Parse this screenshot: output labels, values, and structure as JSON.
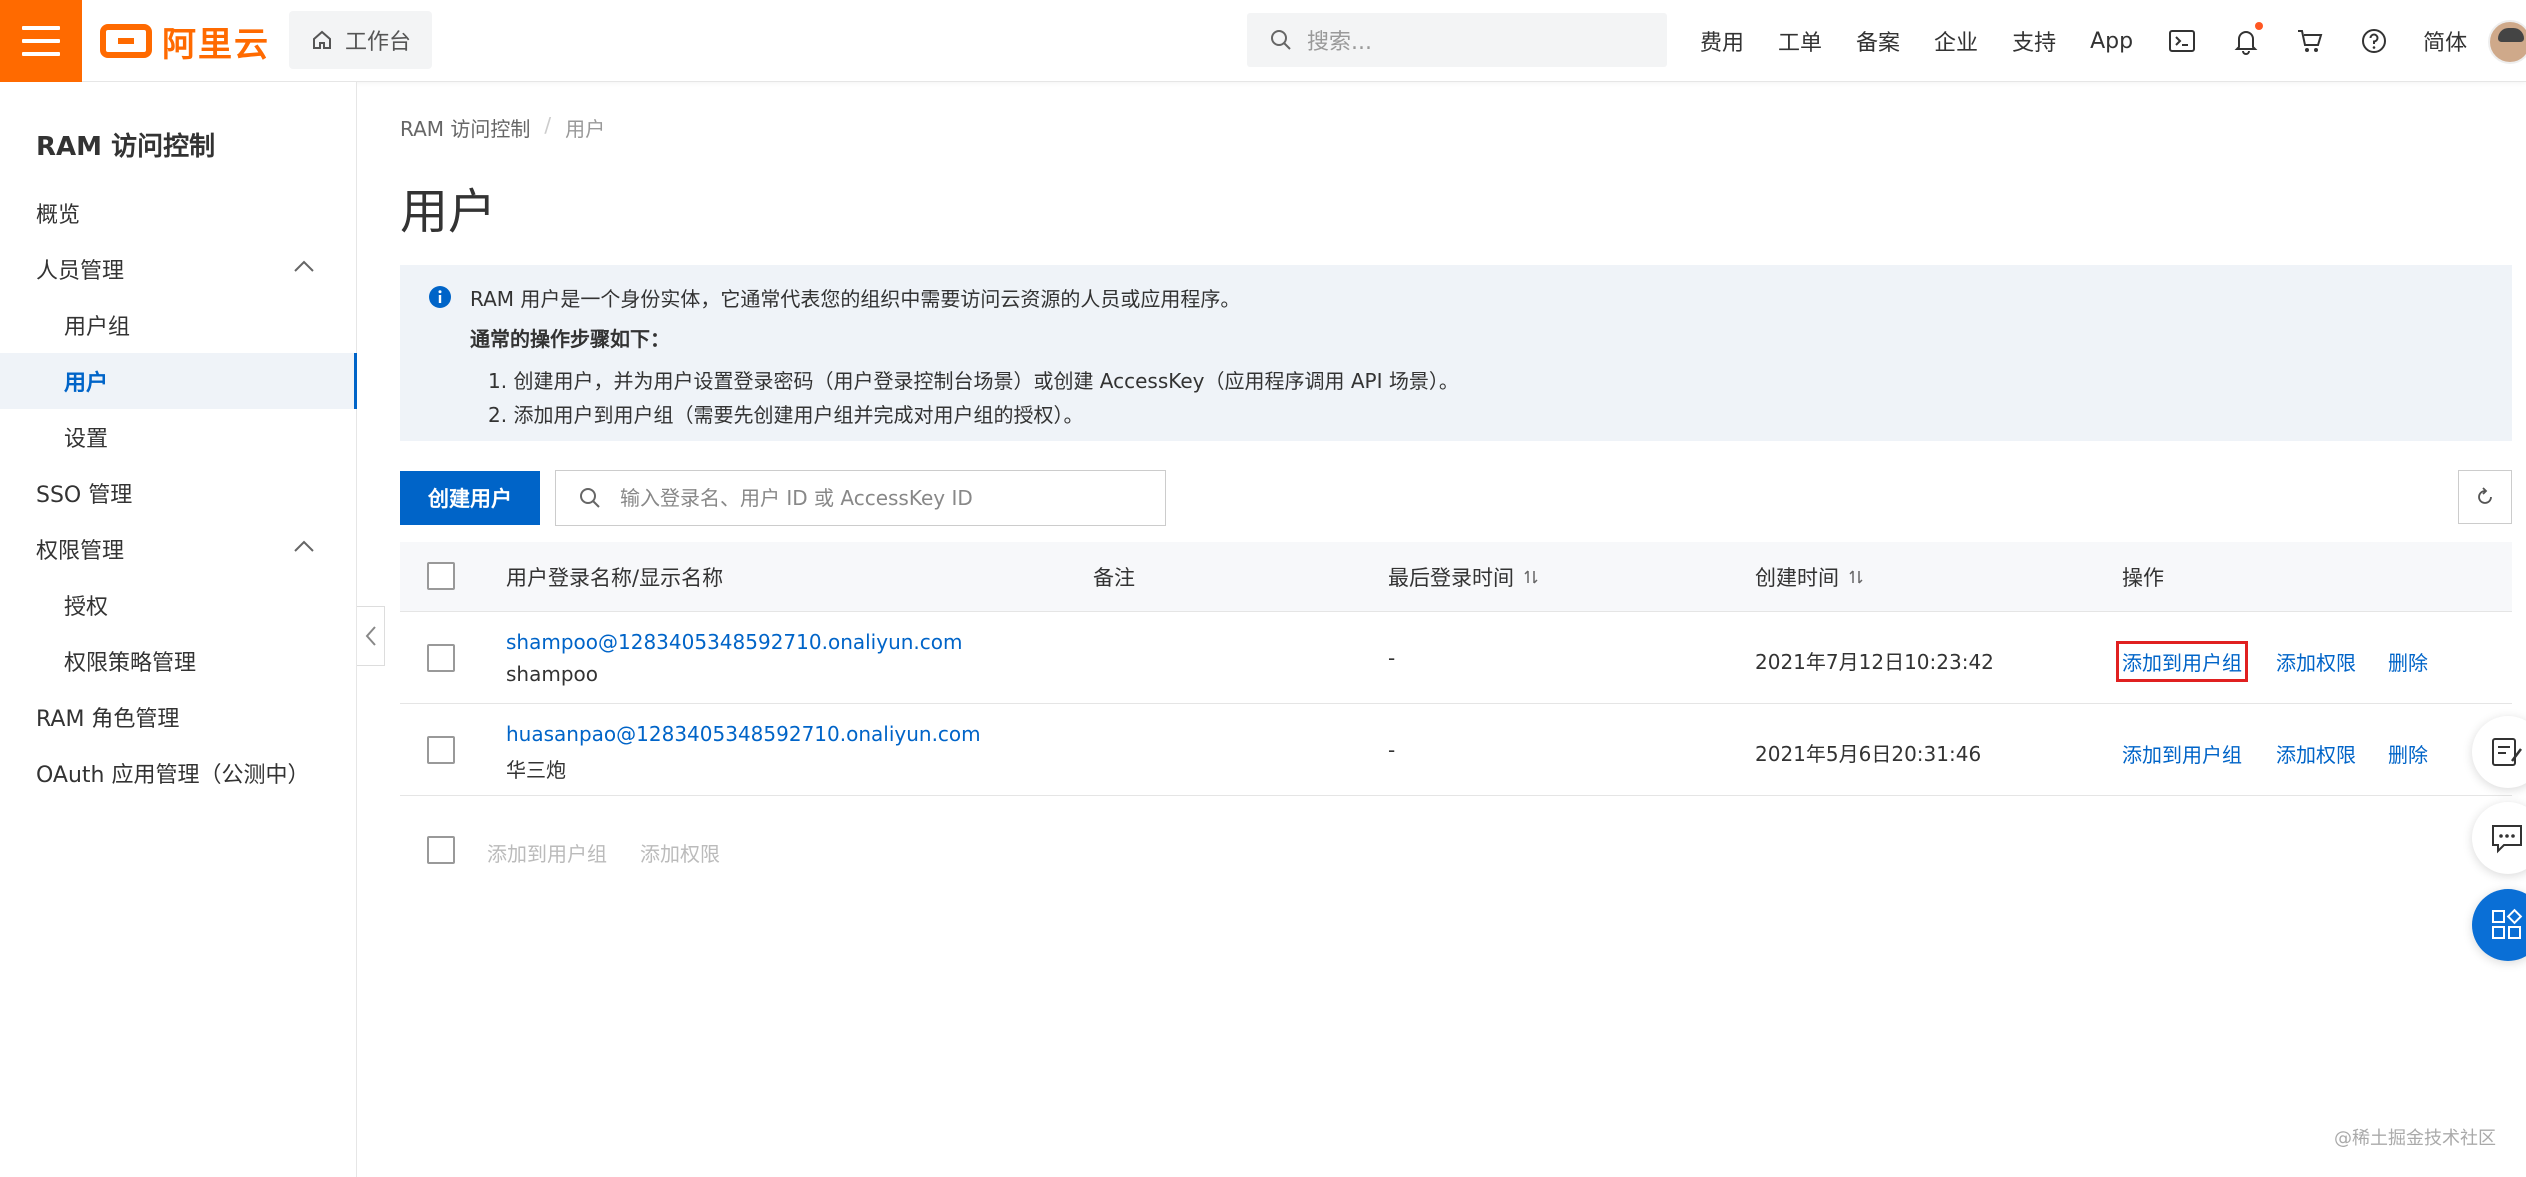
{
  "header": {
    "logo_text": "阿里云",
    "workbench_label": "工作台",
    "search_placeholder": "搜索...",
    "nav": [
      "费用",
      "工单",
      "备案",
      "企业",
      "支持",
      "App"
    ],
    "lang_label": "简体",
    "icons": [
      "terminal-icon",
      "bell-icon",
      "cart-icon",
      "help-icon"
    ]
  },
  "sidebar": {
    "title": "RAM 访问控制",
    "items": [
      {
        "label": "概览"
      },
      {
        "label": "人员管理"
      },
      {
        "label": "用户组"
      },
      {
        "label": "用户"
      },
      {
        "label": "设置"
      },
      {
        "label": "SSO 管理"
      },
      {
        "label": "权限管理"
      },
      {
        "label": "授权"
      },
      {
        "label": "权限策略管理"
      },
      {
        "label": "RAM 角色管理"
      },
      {
        "label": "OAuth 应用管理（公测中）"
      }
    ]
  },
  "breadcrumb": {
    "root": "RAM 访问控制",
    "sep": "/",
    "current": "用户"
  },
  "page_title": "用户",
  "notice": {
    "line1": "RAM 用户是一个身份实体，它通常代表您的组织中需要访问云资源的人员或应用程序。",
    "heading": "通常的操作步骤如下：",
    "step1": "1. 创建用户，并为用户设置登录密码（用户登录控制台场景）或创建 AccessKey（应用程序调用 API 场景）。",
    "step2": "2. 添加用户到用户组（需要先创建用户组并完成对用户组的授权）。"
  },
  "toolbar": {
    "create_label": "创建用户",
    "search_placeholder": "输入登录名、用户 ID 或 AccessKey ID"
  },
  "table": {
    "columns": [
      "用户登录名称/显示名称",
      "备注",
      "最后登录时间",
      "创建时间",
      "操作"
    ],
    "rows": [
      {
        "login": "shampoo@1283405348592710.onaliyun.com",
        "display": "shampoo",
        "note": "",
        "last_login": "-",
        "created": "2021年7月12日10:23:42",
        "actions": [
          "添加到用户组",
          "添加权限",
          "删除"
        ]
      },
      {
        "login": "huasanpao@1283405348592710.onaliyun.com",
        "display": "华三炮",
        "note": "",
        "last_login": "-",
        "created": "2021年5月6日20:31:46",
        "actions": [
          "添加到用户组",
          "添加权限",
          "删除"
        ]
      }
    ]
  },
  "bulk_actions": [
    "添加到用户组",
    "添加权限"
  ],
  "watermark": "@稀土掘金技术社区",
  "colors": {
    "brand": "#ff6a00",
    "primary": "#0064c8",
    "highlight": "#e02020"
  }
}
